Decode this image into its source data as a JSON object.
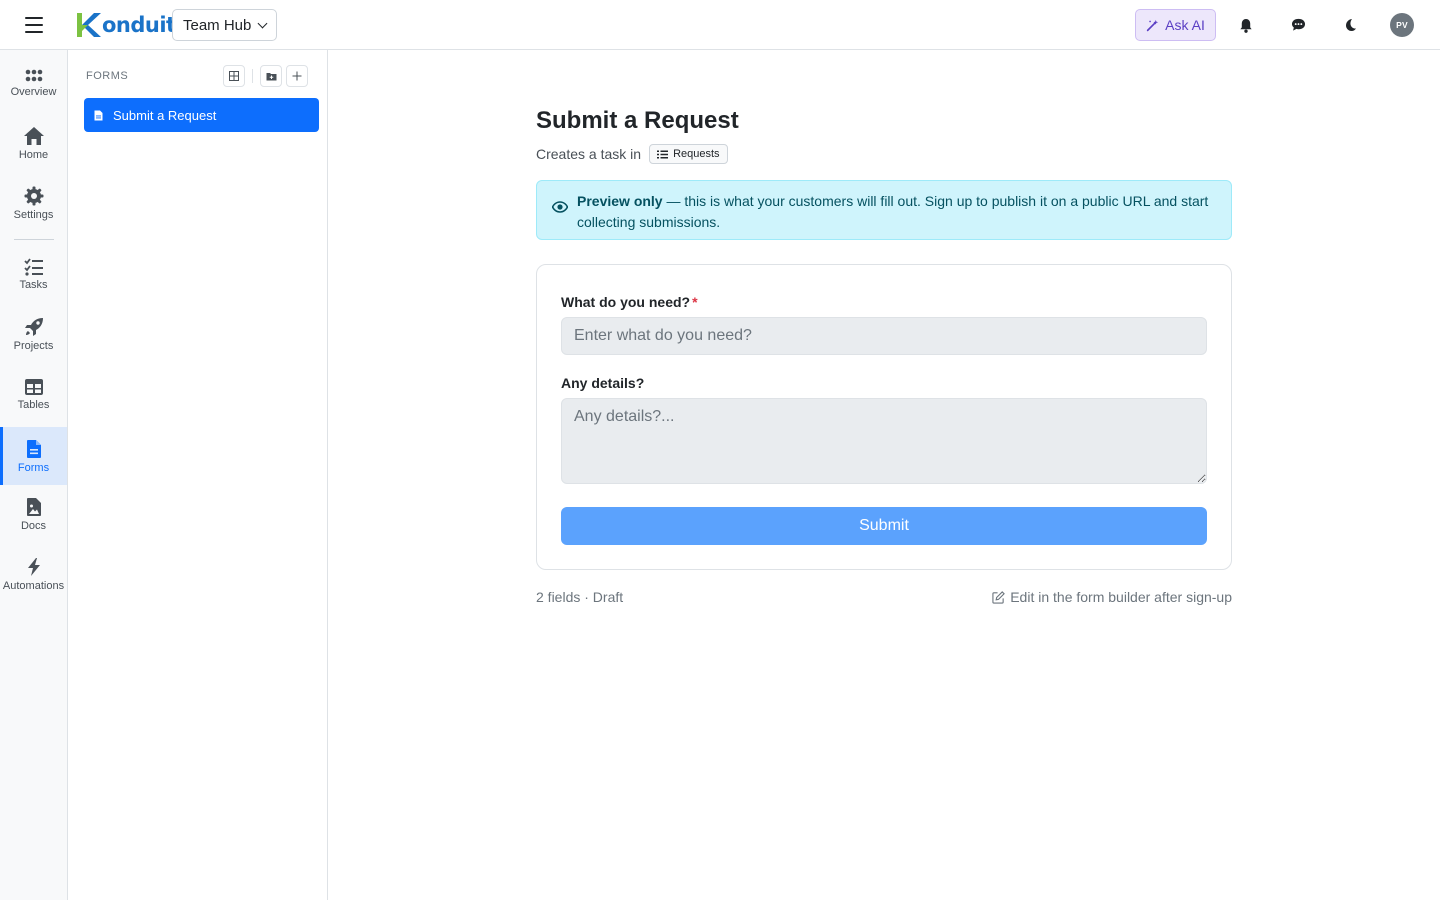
{
  "topbar": {
    "logo_text": "onduit",
    "workspace": "Team Hub",
    "ask_ai": "Ask AI",
    "avatar_initials": "PV",
    "icons": [
      "menu-icon",
      "bell-icon",
      "chat-icon",
      "moon-icon"
    ]
  },
  "rail": {
    "items": [
      {
        "label": "Overview",
        "icon": "grid-dots-icon"
      },
      {
        "label": "Home",
        "icon": "home-icon"
      },
      {
        "label": "Settings",
        "icon": "gear-icon"
      },
      {
        "label": "Tasks",
        "icon": "checklist-icon"
      },
      {
        "label": "Projects",
        "icon": "rocket-icon"
      },
      {
        "label": "Tables",
        "icon": "table-icon"
      },
      {
        "label": "Forms",
        "icon": "form-doc-icon",
        "active": true
      },
      {
        "label": "Docs",
        "icon": "doc-image-icon"
      },
      {
        "label": "Automations",
        "icon": "bolt-icon"
      }
    ]
  },
  "panel": {
    "title": "FORMS",
    "items": [
      {
        "label": "Submit a Request",
        "selected": true
      }
    ]
  },
  "form": {
    "title": "Submit a Request",
    "subtitle_prefix": "Creates a task in",
    "target_badge": "Requests",
    "alert_strong": "Preview only",
    "alert_text": " — this is what your customers will fill out. Sign up to publish it on a public URL and start collecting submissions.",
    "field1_label": "What do you need?",
    "field1_required": "*",
    "field1_placeholder": "Enter what do you need?",
    "field2_label": "Any details?",
    "field2_placeholder": "Any details?...",
    "submit_label": "Submit",
    "footer_meta": "2 fields · Draft",
    "footer_edit": "Edit in the form builder after sign-up"
  },
  "colors": {
    "primary": "#0d6efd",
    "submit": "#5ba2fd",
    "alert_bg": "#cff4fc",
    "ask_ai_bg": "#ede7fb"
  }
}
